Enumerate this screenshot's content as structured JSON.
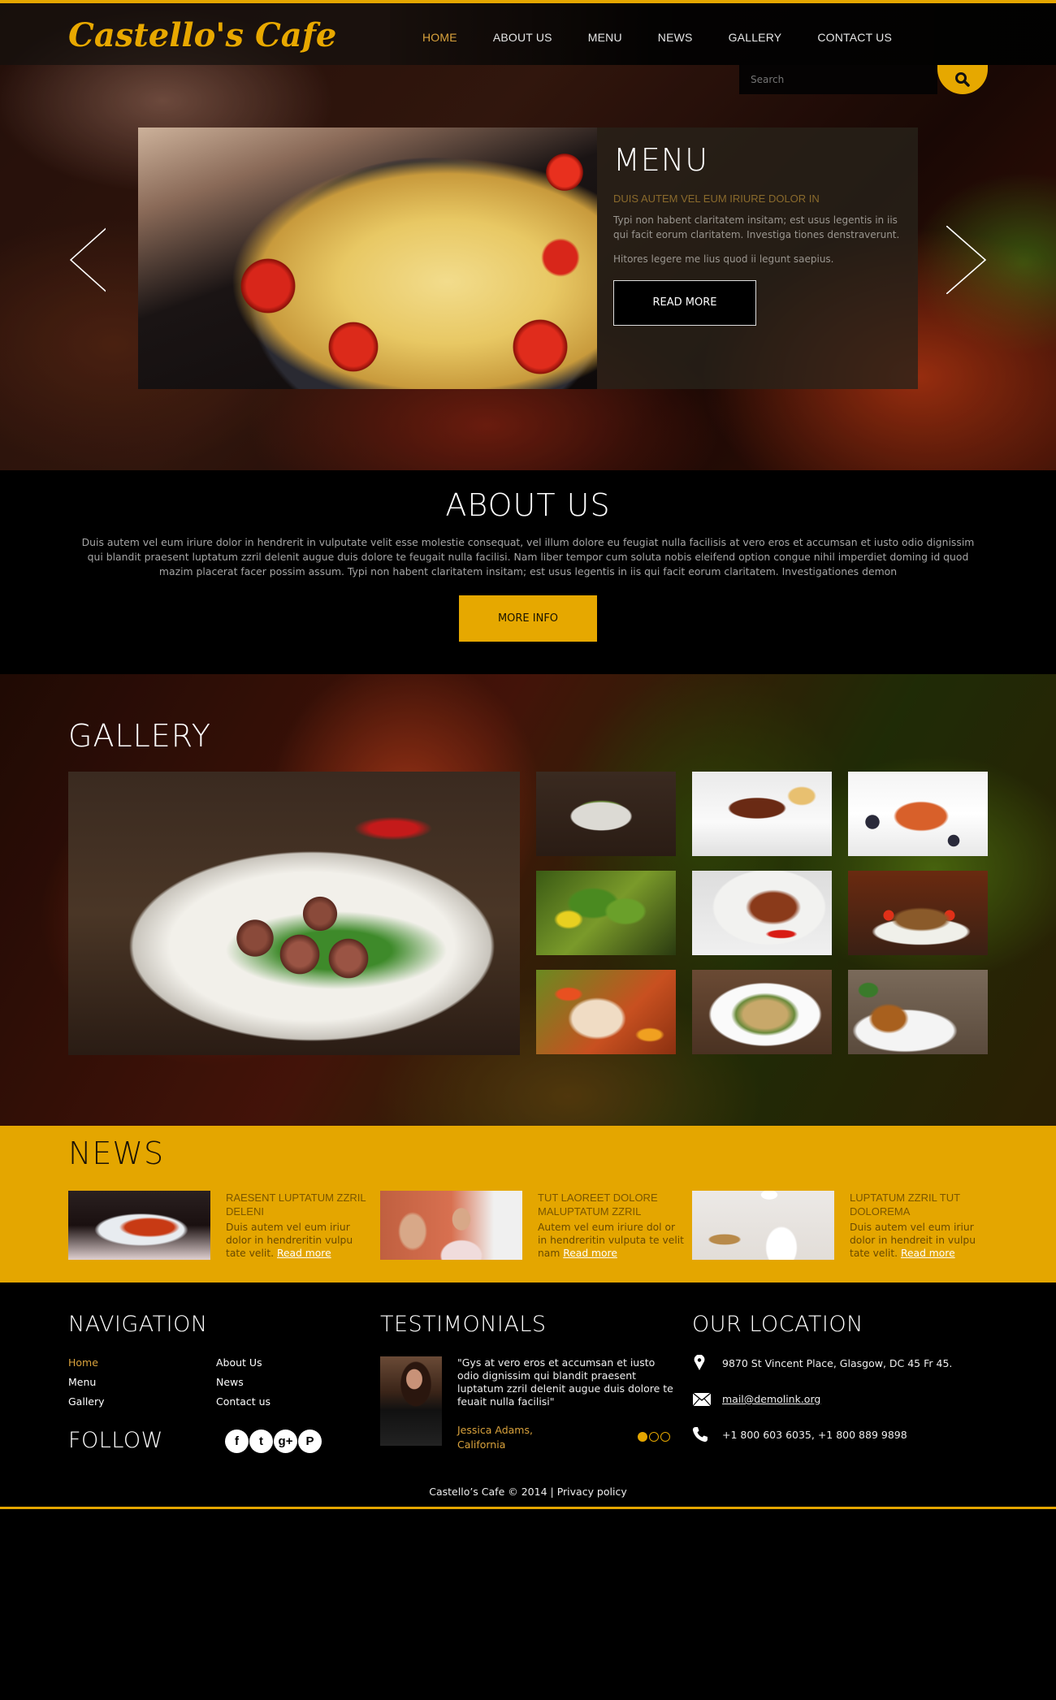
{
  "brand": {
    "logo": "Castello's Cafe",
    "accent": "#e4a600"
  },
  "nav": {
    "items": [
      {
        "label": "HOME",
        "active": true
      },
      {
        "label": "ABOUT US"
      },
      {
        "label": "MENU"
      },
      {
        "label": "NEWS"
      },
      {
        "label": "GALLERY"
      },
      {
        "label": "CONTACT US"
      }
    ]
  },
  "search": {
    "placeholder": "Search",
    "icon": "search-icon"
  },
  "slider": {
    "title": "MENU",
    "subtitle": "DUIS AUTEM VEL EUM IRIURE DOLOR IN",
    "text1": "Typi non habent claritatem insitam; est usus legentis in iis qui facit eorum claritatem. Investiga tiones denstraverunt.",
    "text2": "Hitores legere me lius quod ii legunt saepius.",
    "button": "READ MORE",
    "prev_icon": "chevron-left-icon",
    "next_icon": "chevron-right-icon"
  },
  "about": {
    "title": "ABOUT US",
    "text": "Duis autem vel eum iriure dolor in hendrerit in vulputate velit esse molestie consequat, vel illum dolore eu feugiat nulla facilisis at vero eros et accumsan et iusto odio dignissim qui blandit praesent luptatum zzril delenit augue duis dolore te feugait nulla facilisi. Nam liber tempor cum soluta nobis eleifend option congue nihil imperdiet doming id quod mazim placerat facer possim assum. Typi non habent claritatem insitam; est usus legentis in iis qui facit eorum claritatem. Investigationes demon",
    "button": "MORE INFO"
  },
  "gallery": {
    "title": "GALLERY",
    "main_image": "meat skewers salad bowl",
    "thumbs": [
      "meat skewers salad bowl",
      "bbq ribs with fries",
      "spaghetti with mussels",
      "broccoli stir fry salad",
      "chicken with chili peppers",
      "tacos with salsa",
      "fajita wraps with peppers",
      "green papaya salad",
      "lasagna with basil"
    ]
  },
  "news": {
    "title": "NEWS",
    "items": [
      {
        "heading": "RAESENT LUPTATUM ZZRIL DELENI",
        "text": "Duis autem vel eum iriur dolor in hendreritin vulpu tate velit.",
        "link": "Read more"
      },
      {
        "heading": "TUT LAOREET DOLORE MALUPTATUM ZZRIL",
        "text": "Autem vel eum iriure dol or in hendreritin vulputa te velit nam",
        "link": "Read more"
      },
      {
        "heading": "LUPTATUM ZZRIL TUT DOLOREMA",
        "text": "Duis autem vel eum iriur dolor in hendreit in vulpu tate velit.",
        "link": "Read more"
      }
    ]
  },
  "footer": {
    "navigation": {
      "title": "NAVIGATION",
      "links": [
        {
          "label": "Home",
          "active": true
        },
        {
          "label": "About Us"
        },
        {
          "label": "Menu"
        },
        {
          "label": "News"
        },
        {
          "label": "Gallery"
        },
        {
          "label": "Contact us"
        }
      ]
    },
    "follow": {
      "title": "FOLLOW",
      "social": [
        {
          "name": "facebook",
          "glyph": "f"
        },
        {
          "name": "twitter",
          "glyph": "t"
        },
        {
          "name": "google-plus",
          "glyph": "g+"
        },
        {
          "name": "pinterest",
          "glyph": "P"
        }
      ]
    },
    "testimonials": {
      "title": "TESTIMONIALS",
      "quote": "\"Gys at vero eros et accumsan et iusto odio dignissim qui blandit praesent luptatum zzril delenit augue duis dolore te feuait nulla facilisi\"",
      "author_name": "Jessica Adams,",
      "author_location": "California",
      "pager": {
        "current": 1,
        "total": 3
      }
    },
    "location": {
      "title": "OUR LOCATION",
      "address": "9870 St Vincent Place, Glasgow, DC 45 Fr 45.",
      "email": "mail@demolink.org",
      "phones": "+1 800 603 6035, +1 800 889 9898"
    },
    "copyright": "Castello’s Cafe © 2014 |",
    "privacy": "Privacy policy"
  }
}
